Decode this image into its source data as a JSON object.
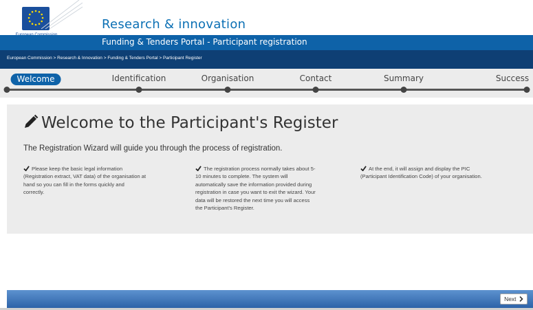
{
  "header": {
    "logo_text": "European Commission",
    "site_title": "Research & innovation",
    "portal_title": "Funding & Tenders Portal - Participant registration"
  },
  "breadcrumb": {
    "text": "European Commission > Research & Innovation > Funding & Tenders Portal > Participant Register"
  },
  "steps": [
    {
      "label": "Welcome",
      "active": true
    },
    {
      "label": "Identification",
      "active": false
    },
    {
      "label": "Organisation",
      "active": false
    },
    {
      "label": "Contact",
      "active": false
    },
    {
      "label": "Summary",
      "active": false
    },
    {
      "label": "Success",
      "active": false
    }
  ],
  "main": {
    "title": "Welcome to the Participant's Register",
    "intro": "The Registration Wizard will guide you through the process of registration.",
    "columns": [
      [
        "Please keep the basic legal information",
        "(Registration extract, VAT data) of the organisation at",
        "hand so you can fill in the forms quickly and",
        "correctly."
      ],
      [
        "The registration process normally takes about 5-",
        "10 minutes to complete. The system will",
        "automatically save the information provided during",
        "registration in case you want to exit the wizard. Your",
        "data will be restored the next time you will access",
        "the Participant's Register."
      ],
      [
        "At the end, it will assign and display the PIC",
        "(Participant Identification Code) of your organisation."
      ]
    ]
  },
  "footer": {
    "next_label": "Next"
  },
  "icons": {
    "pencil": "pencil-icon",
    "check": "check-icon",
    "next": "chevron-right-icon"
  },
  "colors": {
    "brand_blue": "#0e62a8",
    "breadcrumb_bg": "#0e3f74",
    "title_blue": "#0a6fb4",
    "panel_gray": "#ececec"
  }
}
